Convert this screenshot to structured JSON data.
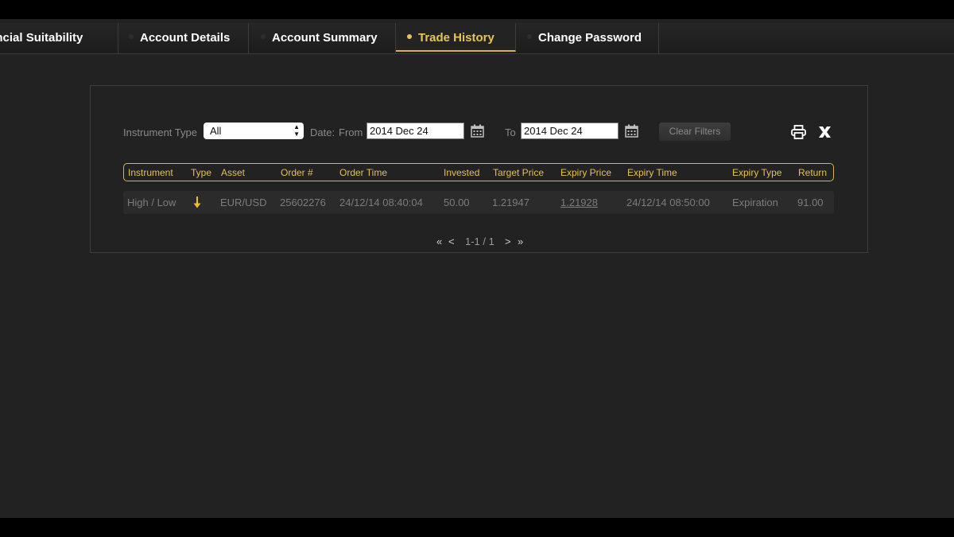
{
  "tabs": [
    {
      "label": "ancial Suitability"
    },
    {
      "label": "Account Details"
    },
    {
      "label": "Account Summary"
    },
    {
      "label": "Trade History"
    },
    {
      "label": "Change Password"
    }
  ],
  "filters": {
    "instrument_type_label": "Instrument Type",
    "instrument_type_value": "All",
    "date_label": "Date:",
    "from_label": "From",
    "from_value": "2014 Dec 24",
    "to_label": "To",
    "to_value": "2014 Dec 24",
    "clear_label": "Clear Filters"
  },
  "table": {
    "columns": [
      "Instrument",
      "Type",
      "Asset",
      "Order #",
      "Order Time",
      "Invested",
      "Target Price",
      "Expiry Price",
      "Expiry Time",
      "Expiry Type",
      "Return"
    ],
    "rows": [
      {
        "instrument": "High / Low",
        "type_icon": "down-arrow-icon",
        "asset": "EUR/USD",
        "order_no": "25602276",
        "order_time": "24/12/14 08:40:04",
        "invested": "50.00",
        "target_price": "1.21947",
        "expiry_price": "1.21928",
        "expiry_time": "24/12/14 08:50:00",
        "expiry_type": "Expiration",
        "return": "91.00"
      }
    ]
  },
  "pager": {
    "first": "«",
    "prev": "<",
    "info": "1-1 / 1",
    "next": ">",
    "last": "»"
  },
  "colors": {
    "accent": "#e3c154",
    "background": "#222222",
    "down_arrow": "#e8c030"
  }
}
